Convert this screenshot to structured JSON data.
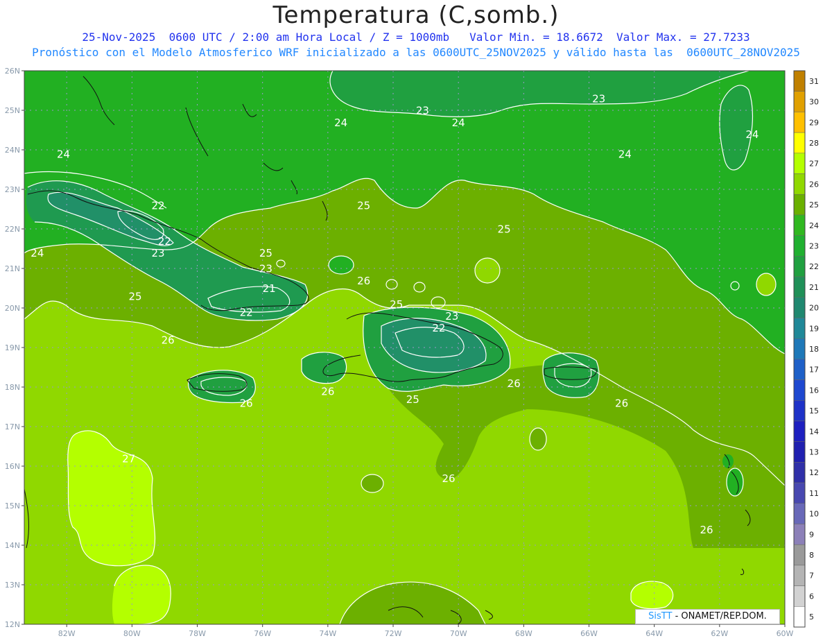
{
  "header": {
    "title": "Temperatura (C,somb.)",
    "line1": "25-Nov-2025  0600 UTC / 2:00 am Hora Local / Z = 1000mb   Valor Min. = 18.6672  Valor Max. = 27.7233",
    "line2": "Pronóstico con el Modelo Atmosferico WRF inicializado a las 0600UTC_25NOV2025 y válido hasta las  0600UTC_28NOV2025"
  },
  "axes": {
    "lat_labels": [
      "26N",
      "25N",
      "24N",
      "23N",
      "22N",
      "21N",
      "20N",
      "19N",
      "18N",
      "17N",
      "16N",
      "15N",
      "14N",
      "13N",
      "12N"
    ],
    "lon_labels": [
      "82W",
      "80W",
      "78W",
      "76W",
      "74W",
      "72W",
      "70W",
      "68W",
      "66W",
      "64W",
      "62W",
      "60W"
    ]
  },
  "colorbar": {
    "values": [
      "31",
      "30",
      "29",
      "28",
      "27",
      "26",
      "25",
      "24",
      "23",
      "22",
      "21",
      "20",
      "19",
      "18",
      "17",
      "16",
      "15",
      "14",
      "13",
      "12",
      "11",
      "10",
      "9",
      "8",
      "7",
      "6",
      "5"
    ],
    "colors": [
      "#c08000",
      "#e0a000",
      "#ffc000",
      "#ffff00",
      "#b4ff00",
      "#90d800",
      "#6ab000",
      "#30b820",
      "#20b030",
      "#20a040",
      "#209058",
      "#208870",
      "#208898",
      "#1e78b8",
      "#1e60c8",
      "#1e48d0",
      "#1e32c8",
      "#1e20c0",
      "#2020b0",
      "#3030a8",
      "#4848b0",
      "#6868b8",
      "#8c80b8",
      "#9a9a9a",
      "#b4b4b4",
      "#d2d2d2",
      "#ffffff"
    ]
  },
  "field_colors": {
    "c24": "#22b022",
    "c25": "#6cb000",
    "c26": "#90d800",
    "c27": "#b4ff00",
    "c23": "#20a040",
    "c22": "#1f9a50",
    "c21": "#219068"
  },
  "contour_labels": [
    {
      "text": "24",
      "lon": -82.1,
      "lat": 23.8
    },
    {
      "text": "24",
      "lon": -73.6,
      "lat": 24.6
    },
    {
      "text": "23",
      "lon": -71.1,
      "lat": 24.9
    },
    {
      "text": "24",
      "lon": -70.0,
      "lat": 24.6
    },
    {
      "text": "23",
      "lon": -65.7,
      "lat": 25.2
    },
    {
      "text": "24",
      "lon": -61.0,
      "lat": 24.3
    },
    {
      "text": "24",
      "lon": -64.9,
      "lat": 23.8
    },
    {
      "text": "24",
      "lon": -82.9,
      "lat": 21.3
    },
    {
      "text": "22",
      "lon": -79.2,
      "lat": 22.5
    },
    {
      "text": "22",
      "lon": -79.0,
      "lat": 21.6
    },
    {
      "text": "23",
      "lon": -79.2,
      "lat": 21.3
    },
    {
      "text": "25",
      "lon": -75.9,
      "lat": 21.3
    },
    {
      "text": "23",
      "lon": -75.9,
      "lat": 20.9
    },
    {
      "text": "25",
      "lon": -72.9,
      "lat": 22.5
    },
    {
      "text": "25",
      "lon": -68.6,
      "lat": 21.9
    },
    {
      "text": "26",
      "lon": -72.9,
      "lat": 20.6
    },
    {
      "text": "25",
      "lon": -79.9,
      "lat": 20.2
    },
    {
      "text": "21",
      "lon": -75.8,
      "lat": 20.4
    },
    {
      "text": "22",
      "lon": -76.5,
      "lat": 19.8
    },
    {
      "text": "26",
      "lon": -78.9,
      "lat": 19.1
    },
    {
      "text": "25",
      "lon": -71.9,
      "lat": 20.0
    },
    {
      "text": "23",
      "lon": -70.2,
      "lat": 19.7
    },
    {
      "text": "22",
      "lon": -70.6,
      "lat": 19.4
    },
    {
      "text": "26",
      "lon": -74.0,
      "lat": 17.8
    },
    {
      "text": "26",
      "lon": -76.5,
      "lat": 17.5
    },
    {
      "text": "25",
      "lon": -71.4,
      "lat": 17.6
    },
    {
      "text": "26",
      "lon": -68.3,
      "lat": 18.0
    },
    {
      "text": "26",
      "lon": -65.0,
      "lat": 17.5
    },
    {
      "text": "27",
      "lon": -80.1,
      "lat": 16.1
    },
    {
      "text": "26",
      "lon": -70.3,
      "lat": 15.6
    },
    {
      "text": "26",
      "lon": -62.4,
      "lat": 14.3
    }
  ],
  "credit": {
    "logo": "SisTT",
    "text": " - ONAMET/REP.DOM."
  }
}
